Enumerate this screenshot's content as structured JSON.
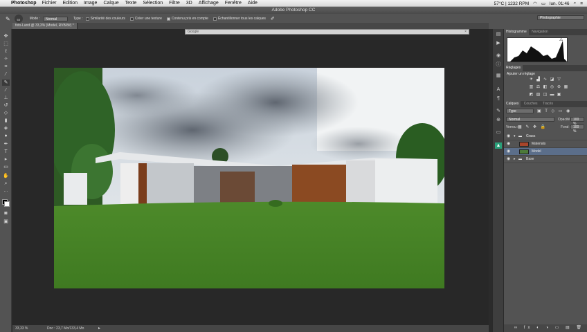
{
  "menubar": {
    "app": "Photoshop",
    "items": [
      "Fichier",
      "Edition",
      "Image",
      "Calque",
      "Texte",
      "Sélection",
      "Filtre",
      "3D",
      "Affichage",
      "Fenêtre",
      "Aide"
    ],
    "status": "57°C | 1232 RPM",
    "clock": "lun. 01:46"
  },
  "window_title": "Adobe Photoshop CC",
  "options": {
    "brush_size": "65",
    "mode_label": "Mode :",
    "mode_value": "Normal",
    "type_label": "Type :",
    "radio1": "Similarité des couleurs",
    "radio2": "Créer une texture",
    "radio3": "Contenu pris en compte",
    "check": "Échantillonner tous les calques",
    "workspace": "Photographie"
  },
  "document_tab": "foto-Land @ 33,3% (Model, RVB/8#) *",
  "google_bar": "Google",
  "status": {
    "zoom": "33,33 %",
    "doc": "Doc : 23,7 Mo/133,4 Mo"
  },
  "panels": {
    "histogram_tab": "Histogramme",
    "navigation_tab": "Navigation",
    "adjust_tab": "Réglages",
    "adjust_title": "Ajouter un réglage",
    "layers_tab": "Calques",
    "channels_tab": "Couches",
    "paths_tab": "Tracés",
    "kind_filter": "Type",
    "blend_mode": "Normal",
    "opacity_label": "Opacité :",
    "opacity_value": "100 %",
    "lock_label": "Verrou :",
    "fill_label": "Fond :",
    "fill_value": "100 %",
    "layers": [
      "Grass",
      "Materials",
      "Model",
      "Base"
    ]
  },
  "colors": {
    "accent": "#5b6e8a"
  }
}
